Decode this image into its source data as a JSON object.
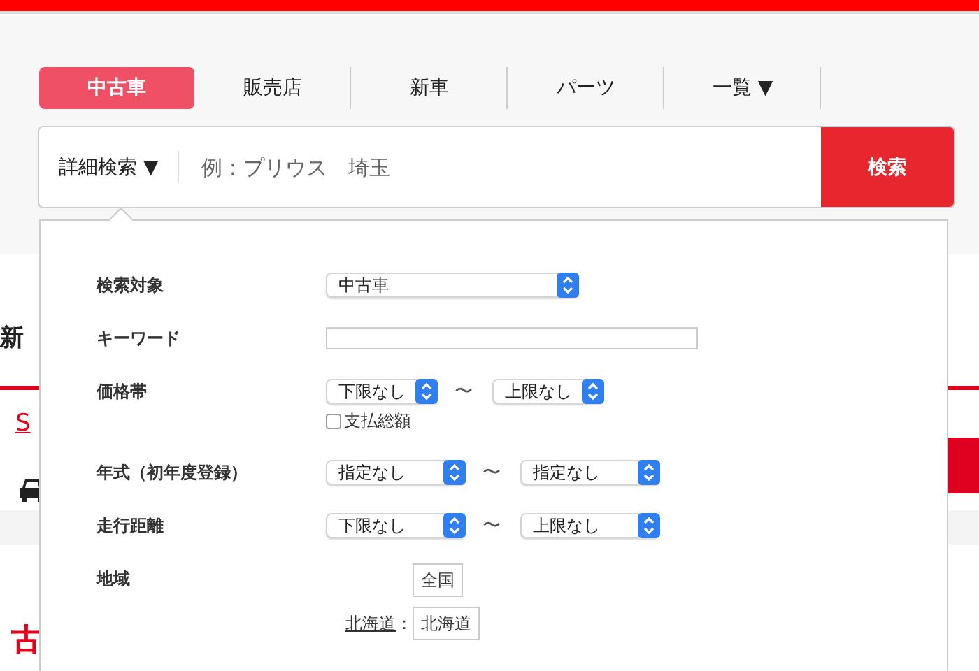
{
  "tabs": [
    {
      "label": "中古車",
      "selected": true
    },
    {
      "label": "販売店",
      "selected": false
    },
    {
      "label": "新車",
      "selected": false
    },
    {
      "label": "パーツ",
      "selected": false
    },
    {
      "label": "一覧 ▼",
      "selected": false
    }
  ],
  "search": {
    "mode_button": "詳細検索 ▼",
    "placeholder": "例：プリウス　埼玉",
    "submit": "検索"
  },
  "background": {
    "heading": "新",
    "link": "S",
    "heading_2": "古"
  },
  "advanced_search": {
    "rows": [
      {
        "label": "検索対象",
        "kind": "select",
        "value": "中古車"
      },
      {
        "label": "キーワード",
        "kind": "text"
      },
      {
        "label": "価格帯",
        "kind": "range",
        "from": "下限なし",
        "separator": "〜",
        "to": "上限なし",
        "checkbox": {
          "label": "支払総額",
          "checked": false
        }
      },
      {
        "label": "年式（初年度登録）",
        "kind": "range",
        "from": "指定なし",
        "separator": "〜",
        "to": "指定なし"
      },
      {
        "label": "走行距離",
        "kind": "range",
        "from": "下限なし",
        "separator": "〜",
        "to": "上限なし"
      },
      {
        "label": "地域",
        "kind": "region",
        "groups": [
          {
            "buttons": [
              "全国"
            ]
          },
          {
            "name": "北海道",
            "separator": "：",
            "buttons": [
              "北海道"
            ]
          }
        ]
      }
    ]
  }
}
